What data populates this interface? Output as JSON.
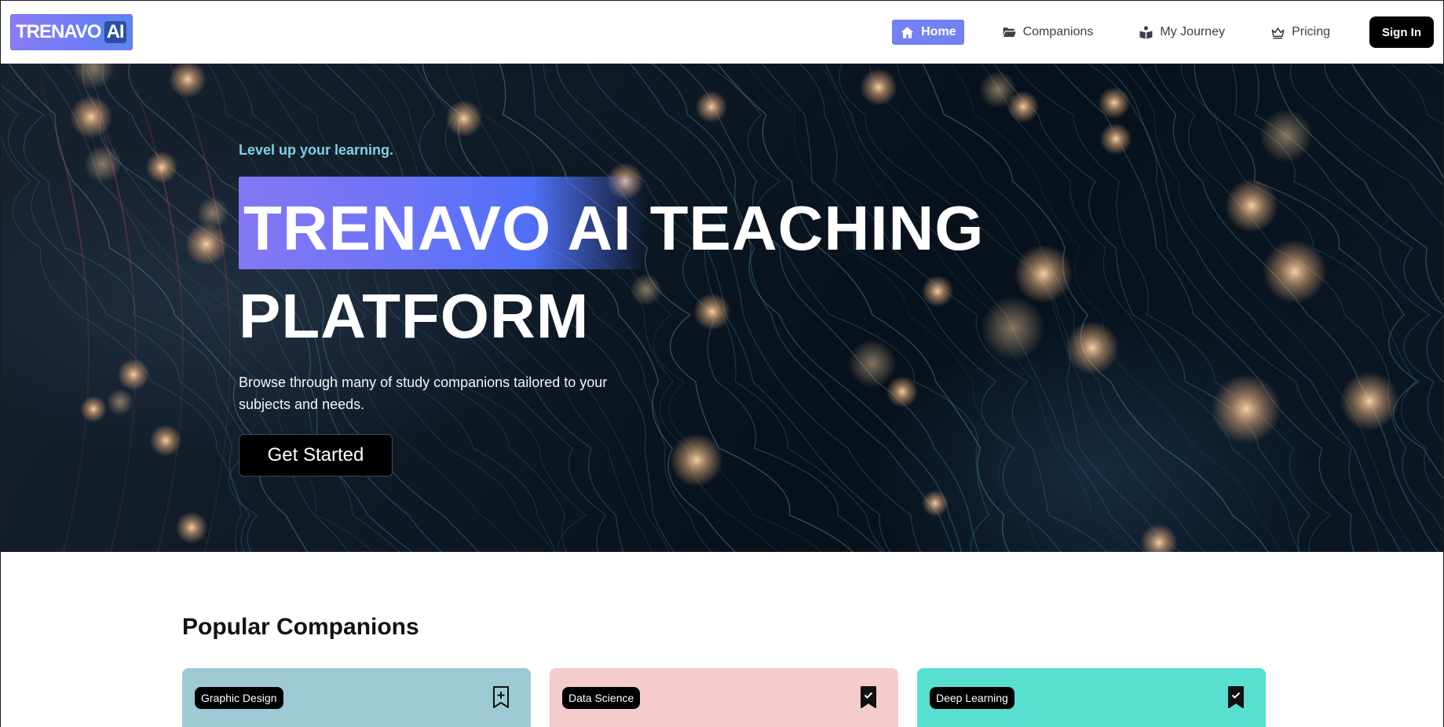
{
  "brand": {
    "name": "TRENAVO",
    "suffix": "AI"
  },
  "nav": {
    "items": [
      {
        "label": "Home",
        "icon": "home-icon",
        "active": true
      },
      {
        "label": "Companions",
        "icon": "folder-open-icon",
        "active": false
      },
      {
        "label": "My Journey",
        "icon": "book-reader-icon",
        "active": false
      },
      {
        "label": "Pricing",
        "icon": "crown-icon",
        "active": false
      }
    ],
    "sign_in": "Sign In"
  },
  "hero": {
    "eyebrow": "Level up your learning.",
    "headline_line1": "TRENAVO AI TEACHING",
    "headline_line2": "PLATFORM",
    "description": "Browse through many of study companions tailored to your subjects and needs.",
    "cta": "Get Started"
  },
  "popular": {
    "title": "Popular Companions",
    "cards": [
      {
        "subject": "Graphic Design",
        "color": "#9ecad5",
        "bookmarked": false
      },
      {
        "subject": "Data Science",
        "color": "#f5cbcb",
        "bookmarked": true
      },
      {
        "subject": "Deep Learning",
        "color": "#58dfd0",
        "bookmarked": true
      }
    ]
  },
  "colors": {
    "accent": "#7481f3",
    "hero_bg": "#0b1824",
    "eyebrow": "#7fd0e6"
  }
}
